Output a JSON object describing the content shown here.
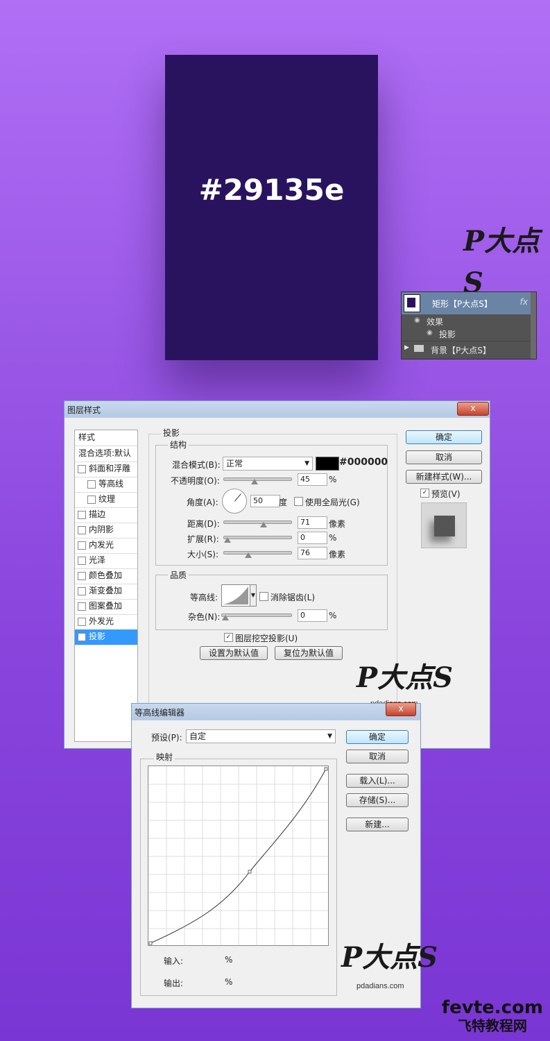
{
  "swatch": {
    "hex_label": "#29135e",
    "color": "#29135e"
  },
  "watermark": {
    "logo_text": "P大点S",
    "site": "pdadians.com"
  },
  "layers_panel": {
    "layer_name": "矩形【P大点S】",
    "fx": "fx",
    "effects_label": "效果",
    "shadow_label": "投影",
    "bg_name": "背景【P大点S】"
  },
  "layer_style": {
    "title": "图层样式",
    "close": "x",
    "styles_header": "样式",
    "blend_options": "混合选项:默认",
    "items": [
      {
        "label": "斜面和浮雕",
        "checked": false,
        "indent": false
      },
      {
        "label": "等高线",
        "checked": false,
        "indent": true
      },
      {
        "label": "纹理",
        "checked": false,
        "indent": true
      },
      {
        "label": "描边",
        "checked": false,
        "indent": false
      },
      {
        "label": "内阴影",
        "checked": false,
        "indent": false
      },
      {
        "label": "内发光",
        "checked": false,
        "indent": false
      },
      {
        "label": "光泽",
        "checked": false,
        "indent": false
      },
      {
        "label": "颜色叠加",
        "checked": false,
        "indent": false
      },
      {
        "label": "渐变叠加",
        "checked": false,
        "indent": false
      },
      {
        "label": "图案叠加",
        "checked": false,
        "indent": false
      },
      {
        "label": "外发光",
        "checked": false,
        "indent": false
      },
      {
        "label": "投影",
        "checked": true,
        "indent": false,
        "selected": true
      }
    ],
    "section_title": "投影",
    "structure_title": "结构",
    "blend_mode_label": "混合模式(B):",
    "blend_mode_value": "正常",
    "shadow_color_hex": "#000000",
    "opacity_label": "不透明度(O):",
    "opacity_value": "45",
    "angle_label": "角度(A):",
    "angle_value": "50",
    "angle_unit": "度",
    "global_light_label": "使用全局光(G)",
    "distance_label": "距离(D):",
    "distance_value": "71",
    "spread_label": "扩展(R):",
    "spread_value": "0",
    "size_label": "大小(S):",
    "size_value": "76",
    "px_unit": "像素",
    "pct_unit": "%",
    "quality_title": "品质",
    "contour_label": "等高线:",
    "antialias_label": "消除锯齿(L)",
    "noise_label": "杂色(N):",
    "noise_value": "0",
    "knockout_label": "图层挖空投影(U)",
    "make_default": "设置为默认值",
    "reset_default": "复位为默认值",
    "ok": "确定",
    "cancel": "取消",
    "new_style": "新建样式(W)...",
    "preview_label": "预览(V)",
    "opacity_fraction": 0.45,
    "distance_fraction": 0.6,
    "spread_fraction": 0.0,
    "size_fraction": 0.34,
    "noise_fraction": 0.0
  },
  "contour_editor": {
    "title": "等高线编辑器",
    "preset_label": "预设(P):",
    "preset_value": "自定",
    "mapping_title": "映射",
    "ok": "确定",
    "cancel": "取消",
    "load": "载入(L)...",
    "save": "存储(S)...",
    "new": "新建...",
    "input_label": "输入:",
    "output_label": "输出:",
    "pct": "%"
  },
  "site_watermark": {
    "line1": "fevte.com",
    "line2": "飞特教程网"
  }
}
